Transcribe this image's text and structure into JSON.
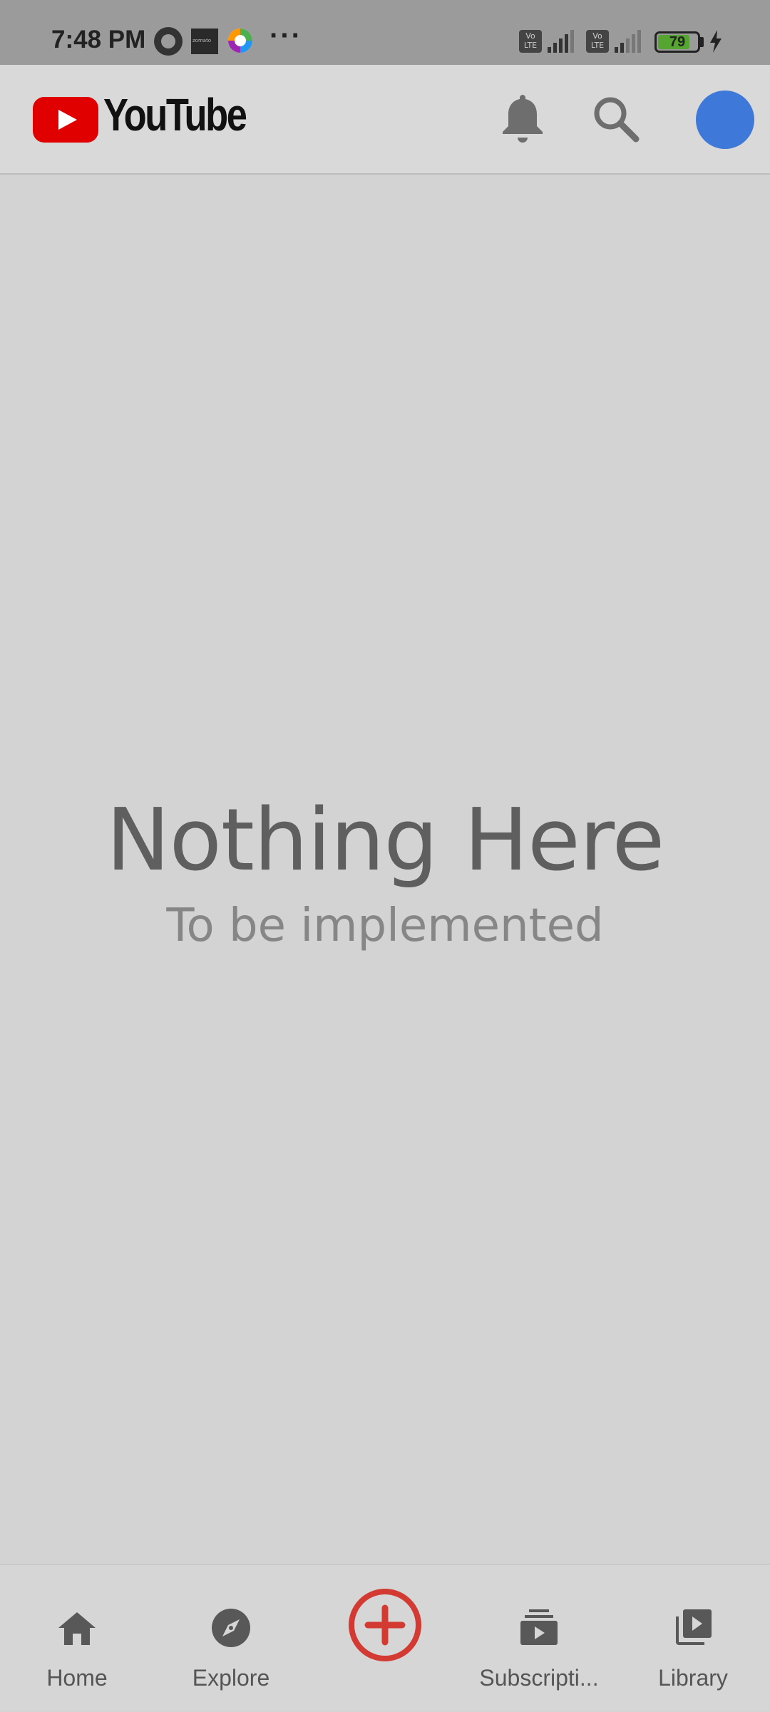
{
  "status_bar": {
    "time": "7:48 PM",
    "battery_level": "79",
    "icons": [
      "whatsapp-icon",
      "zomato-icon",
      "lens-icon",
      "more-dots-icon",
      "volte-icon",
      "signal-icon",
      "battery-icon",
      "charging-icon"
    ],
    "zomato_text": "zomato",
    "volte_text": "Vo LTE"
  },
  "header": {
    "logo_text": "YouTube",
    "brand_color": "#e00000",
    "avatar_color": "#3e78d8"
  },
  "main": {
    "title": "Nothing Here",
    "subtitle": "To be implemented"
  },
  "bottom_nav": {
    "items": [
      {
        "label": "Home",
        "icon": "home-icon"
      },
      {
        "label": "Explore",
        "icon": "compass-icon"
      },
      {
        "label": "",
        "icon": "add-circle-icon"
      },
      {
        "label": "Subscripti...",
        "icon": "subscriptions-icon"
      },
      {
        "label": "Library",
        "icon": "library-icon"
      }
    ],
    "create_color": "#d33a32"
  }
}
